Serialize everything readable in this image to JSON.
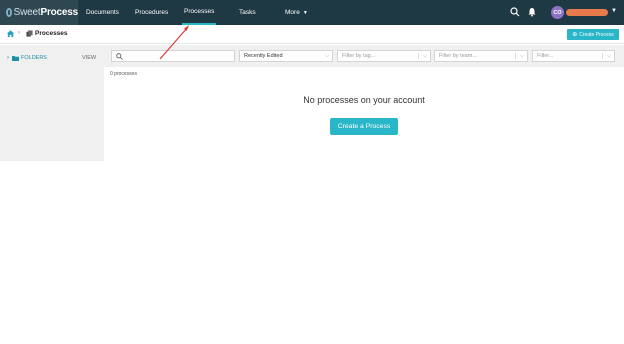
{
  "brand": {
    "name_light": "Sweet",
    "name_bold": "Process"
  },
  "nav": {
    "items": [
      {
        "label": "Documents"
      },
      {
        "label": "Procedures"
      },
      {
        "label": "Processes"
      },
      {
        "label": "Tasks"
      },
      {
        "label": "More"
      }
    ],
    "active": "Processes"
  },
  "user": {
    "initials": "CO"
  },
  "breadcrumb": {
    "title": "Processes"
  },
  "actions": {
    "create_top_label": "Create Process"
  },
  "sidebar": {
    "folders_label": "FOLDERS",
    "view_label": "VIEW"
  },
  "filters": {
    "search_placeholder": "",
    "sort_value": "Recently Edited",
    "tag_placeholder": "Filter by tag...",
    "team_placeholder": "Filter by team...",
    "filter_placeholder": "Filter..."
  },
  "content": {
    "count_text": "0 processes",
    "empty_message": "No processes on your account",
    "create_button_label": "Create a Process"
  },
  "colors": {
    "accent": "#2ab6c9",
    "nav_bg": "#1f3944",
    "annotation_arrow": "#d9362b"
  }
}
